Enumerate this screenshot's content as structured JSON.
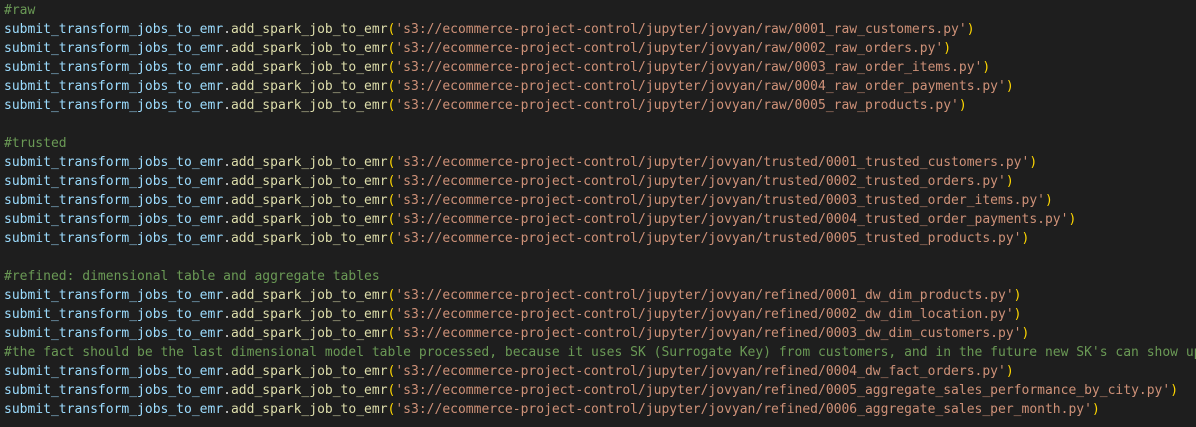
{
  "editor": {
    "lines": [
      {
        "kind": "comment",
        "text": "#raw"
      },
      {
        "kind": "call",
        "obj": "submit_transform_jobs_to_emr",
        "func": "add_spark_job_to_emr",
        "arg": "'s3://ecommerce-project-control/jupyter/jovyan/raw/0001_raw_customers.py'"
      },
      {
        "kind": "call",
        "obj": "submit_transform_jobs_to_emr",
        "func": "add_spark_job_to_emr",
        "arg": "'s3://ecommerce-project-control/jupyter/jovyan/raw/0002_raw_orders.py'"
      },
      {
        "kind": "call",
        "obj": "submit_transform_jobs_to_emr",
        "func": "add_spark_job_to_emr",
        "arg": "'s3://ecommerce-project-control/jupyter/jovyan/raw/0003_raw_order_items.py'"
      },
      {
        "kind": "call",
        "obj": "submit_transform_jobs_to_emr",
        "func": "add_spark_job_to_emr",
        "arg": "'s3://ecommerce-project-control/jupyter/jovyan/raw/0004_raw_order_payments.py'"
      },
      {
        "kind": "call",
        "obj": "submit_transform_jobs_to_emr",
        "func": "add_spark_job_to_emr",
        "arg": "'s3://ecommerce-project-control/jupyter/jovyan/raw/0005_raw_products.py'"
      },
      {
        "kind": "blank",
        "text": ""
      },
      {
        "kind": "comment",
        "text": "#trusted"
      },
      {
        "kind": "call",
        "obj": "submit_transform_jobs_to_emr",
        "func": "add_spark_job_to_emr",
        "arg": "'s3://ecommerce-project-control/jupyter/jovyan/trusted/0001_trusted_customers.py'"
      },
      {
        "kind": "call",
        "obj": "submit_transform_jobs_to_emr",
        "func": "add_spark_job_to_emr",
        "arg": "'s3://ecommerce-project-control/jupyter/jovyan/trusted/0002_trusted_orders.py'"
      },
      {
        "kind": "call",
        "obj": "submit_transform_jobs_to_emr",
        "func": "add_spark_job_to_emr",
        "arg": "'s3://ecommerce-project-control/jupyter/jovyan/trusted/0003_trusted_order_items.py'"
      },
      {
        "kind": "call",
        "obj": "submit_transform_jobs_to_emr",
        "func": "add_spark_job_to_emr",
        "arg": "'s3://ecommerce-project-control/jupyter/jovyan/trusted/0004_trusted_order_payments.py'"
      },
      {
        "kind": "call",
        "obj": "submit_transform_jobs_to_emr",
        "func": "add_spark_job_to_emr",
        "arg": "'s3://ecommerce-project-control/jupyter/jovyan/trusted/0005_trusted_products.py'"
      },
      {
        "kind": "blank",
        "text": ""
      },
      {
        "kind": "comment",
        "text": "#refined: dimensional table and aggregate tables"
      },
      {
        "kind": "call",
        "obj": "submit_transform_jobs_to_emr",
        "func": "add_spark_job_to_emr",
        "arg": "'s3://ecommerce-project-control/jupyter/jovyan/refined/0001_dw_dim_products.py'"
      },
      {
        "kind": "call",
        "obj": "submit_transform_jobs_to_emr",
        "func": "add_spark_job_to_emr",
        "arg": "'s3://ecommerce-project-control/jupyter/jovyan/refined/0002_dw_dim_location.py'"
      },
      {
        "kind": "call",
        "obj": "submit_transform_jobs_to_emr",
        "func": "add_spark_job_to_emr",
        "arg": "'s3://ecommerce-project-control/jupyter/jovyan/refined/0003_dw_dim_customers.py'"
      },
      {
        "kind": "comment",
        "text": "#the fact should be the last dimensional model table processed, because it uses SK (Surrogate Key) from customers, and in the future new SK's can show up."
      },
      {
        "kind": "call",
        "obj": "submit_transform_jobs_to_emr",
        "func": "add_spark_job_to_emr",
        "arg": "'s3://ecommerce-project-control/jupyter/jovyan/refined/0004_dw_fact_orders.py'"
      },
      {
        "kind": "call",
        "obj": "submit_transform_jobs_to_emr",
        "func": "add_spark_job_to_emr",
        "arg": "'s3://ecommerce-project-control/jupyter/jovyan/refined/0005_aggregate_sales_performance_by_city.py'"
      },
      {
        "kind": "call",
        "obj": "submit_transform_jobs_to_emr",
        "func": "add_spark_job_to_emr",
        "arg": "'s3://ecommerce-project-control/jupyter/jovyan/refined/0006_aggregate_sales_per_month.py'"
      }
    ]
  },
  "theme": {
    "background": "#1e1e1e",
    "comment": "#6a9955",
    "identifier": "#9cdcfe",
    "function": "#dcdcaa",
    "bracket": "#ffd700",
    "string": "#ce9178",
    "punctuation": "#d4d4d4"
  }
}
